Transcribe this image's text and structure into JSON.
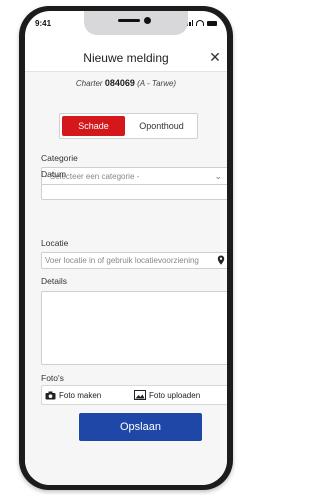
{
  "status_bar": {
    "time": "9:41"
  },
  "header": {
    "title": "Nieuwe melding",
    "close_icon": "close-icon"
  },
  "charter": {
    "label": "Charter",
    "number": "084069",
    "sub": "(A - Tarwe)"
  },
  "type_toggle": {
    "options": [
      "Schade",
      "Oponthoud"
    ],
    "selected": "Schade",
    "selected_color": "#d3171b"
  },
  "categorie": {
    "label": "Categorie",
    "placeholder": "- Selecteer een categorie -"
  },
  "datum": {
    "label": "Datum",
    "value": ""
  },
  "locatie": {
    "label": "Locatie",
    "placeholder": "Voer locatie in of gebruik locatievoorziening",
    "icon": "location-pin-icon"
  },
  "details": {
    "label": "Details",
    "value": ""
  },
  "fotos": {
    "label": "Foto's",
    "take_label": "Foto maken",
    "upload_label": "Foto uploaden"
  },
  "save": {
    "label": "Opslaan",
    "color": "#1f47a8"
  }
}
